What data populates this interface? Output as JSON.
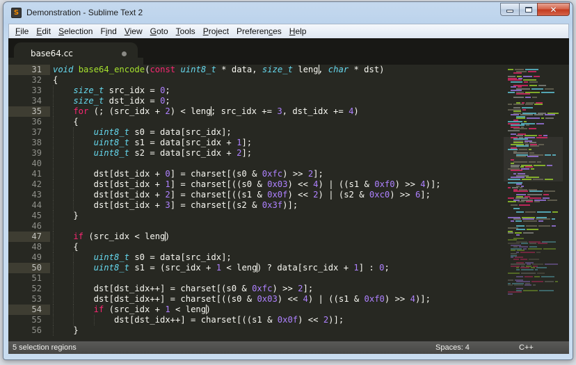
{
  "window": {
    "title": "Demonstration - Sublime Text 2",
    "app_icon_glyph": "S",
    "controls": {
      "minimize": "minimize",
      "maximize": "maximize",
      "close": "✕"
    }
  },
  "menu": [
    {
      "label": "File",
      "mnemonic_index": 0
    },
    {
      "label": "Edit",
      "mnemonic_index": 0
    },
    {
      "label": "Selection",
      "mnemonic_index": 0
    },
    {
      "label": "Find",
      "mnemonic_index": 1
    },
    {
      "label": "View",
      "mnemonic_index": 0
    },
    {
      "label": "Goto",
      "mnemonic_index": 0
    },
    {
      "label": "Tools",
      "mnemonic_index": 0
    },
    {
      "label": "Project",
      "mnemonic_index": 0
    },
    {
      "label": "Preferences",
      "mnemonic_index": 8
    },
    {
      "label": "Help",
      "mnemonic_index": 0
    }
  ],
  "tabs": [
    {
      "label": "base64.cc",
      "modified": true,
      "active": true
    }
  ],
  "colors": {
    "background": "#272822",
    "storage": "#66d9ef",
    "keyword": "#f92672",
    "function": "#a6e22e",
    "number": "#ae81ff",
    "text": "#f8f8f2",
    "line_highlight": "#3e3d32"
  },
  "editor": {
    "highlighted_lines": [
      31,
      35,
      47,
      50,
      54
    ],
    "lines": [
      {
        "n": 31,
        "indent": 0,
        "tokens": [
          [
            "s",
            "void"
          ],
          [
            "p",
            " "
          ],
          [
            "f",
            "base64_encode"
          ],
          [
            "p",
            "("
          ],
          [
            "k",
            "const"
          ],
          [
            "p",
            " "
          ],
          [
            "s",
            "uint8_t"
          ],
          [
            "p",
            " * data, "
          ],
          [
            "s",
            "size_t"
          ],
          [
            "p",
            " leng"
          ],
          [
            "c",
            ""
          ],
          [
            "p",
            ", "
          ],
          [
            "s",
            "char"
          ],
          [
            "p",
            " * dst)"
          ]
        ]
      },
      {
        "n": 32,
        "indent": 0,
        "tokens": [
          [
            "p",
            "{"
          ]
        ]
      },
      {
        "n": 33,
        "indent": 1,
        "tokens": [
          [
            "s",
            "size_t"
          ],
          [
            "p",
            " src_idx = "
          ],
          [
            "n",
            "0"
          ],
          [
            "p",
            ";"
          ]
        ]
      },
      {
        "n": 34,
        "indent": 1,
        "tokens": [
          [
            "s",
            "size_t"
          ],
          [
            "p",
            " dst_idx = "
          ],
          [
            "n",
            "0"
          ],
          [
            "p",
            ";"
          ]
        ]
      },
      {
        "n": 35,
        "indent": 1,
        "tokens": [
          [
            "k",
            "for"
          ],
          [
            "p",
            " (; (src_idx + "
          ],
          [
            "n",
            "2"
          ],
          [
            "p",
            ") < leng"
          ],
          [
            "c",
            ""
          ],
          [
            "p",
            "; src_idx += "
          ],
          [
            "n",
            "3"
          ],
          [
            "p",
            ", dst_idx += "
          ],
          [
            "n",
            "4"
          ],
          [
            "p",
            ")"
          ]
        ]
      },
      {
        "n": 36,
        "indent": 1,
        "tokens": [
          [
            "p",
            "{"
          ]
        ]
      },
      {
        "n": 37,
        "indent": 2,
        "tokens": [
          [
            "s",
            "uint8_t"
          ],
          [
            "p",
            " s0 = data[src_idx];"
          ]
        ]
      },
      {
        "n": 38,
        "indent": 2,
        "tokens": [
          [
            "s",
            "uint8_t"
          ],
          [
            "p",
            " s1 = data[src_idx + "
          ],
          [
            "n",
            "1"
          ],
          [
            "p",
            "];"
          ]
        ]
      },
      {
        "n": 39,
        "indent": 2,
        "tokens": [
          [
            "s",
            "uint8_t"
          ],
          [
            "p",
            " s2 = data[src_idx + "
          ],
          [
            "n",
            "2"
          ],
          [
            "p",
            "];"
          ]
        ]
      },
      {
        "n": 40,
        "indent": 2,
        "tokens": []
      },
      {
        "n": 41,
        "indent": 2,
        "tokens": [
          [
            "p",
            "dst[dst_idx + "
          ],
          [
            "n",
            "0"
          ],
          [
            "p",
            "] = charset[(s0 & "
          ],
          [
            "n",
            "0xfc"
          ],
          [
            "p",
            ") >> "
          ],
          [
            "n",
            "2"
          ],
          [
            "p",
            "];"
          ]
        ]
      },
      {
        "n": 42,
        "indent": 2,
        "tokens": [
          [
            "p",
            "dst[dst_idx + "
          ],
          [
            "n",
            "1"
          ],
          [
            "p",
            "] = charset[((s0 & "
          ],
          [
            "n",
            "0x03"
          ],
          [
            "p",
            ") << "
          ],
          [
            "n",
            "4"
          ],
          [
            "p",
            ") | ((s1 & "
          ],
          [
            "n",
            "0xf0"
          ],
          [
            "p",
            ") >> "
          ],
          [
            "n",
            "4"
          ],
          [
            "p",
            ")];"
          ]
        ]
      },
      {
        "n": 43,
        "indent": 2,
        "tokens": [
          [
            "p",
            "dst[dst_idx + "
          ],
          [
            "n",
            "2"
          ],
          [
            "p",
            "] = charset[((s1 & "
          ],
          [
            "n",
            "0x0f"
          ],
          [
            "p",
            ") << "
          ],
          [
            "n",
            "2"
          ],
          [
            "p",
            ") | (s2 & "
          ],
          [
            "n",
            "0xc0"
          ],
          [
            "p",
            ") >> "
          ],
          [
            "n",
            "6"
          ],
          [
            "p",
            "];"
          ]
        ]
      },
      {
        "n": 44,
        "indent": 2,
        "tokens": [
          [
            "p",
            "dst[dst_idx + "
          ],
          [
            "n",
            "3"
          ],
          [
            "p",
            "] = charset[(s2 & "
          ],
          [
            "n",
            "0x3f"
          ],
          [
            "p",
            ")];"
          ]
        ]
      },
      {
        "n": 45,
        "indent": 1,
        "tokens": [
          [
            "p",
            "}"
          ]
        ]
      },
      {
        "n": 46,
        "indent": 1,
        "tokens": []
      },
      {
        "n": 47,
        "indent": 1,
        "tokens": [
          [
            "k",
            "if"
          ],
          [
            "p",
            " (src_idx < leng"
          ],
          [
            "c",
            ""
          ],
          [
            "p",
            ")"
          ]
        ]
      },
      {
        "n": 48,
        "indent": 1,
        "tokens": [
          [
            "p",
            "{"
          ]
        ]
      },
      {
        "n": 49,
        "indent": 2,
        "tokens": [
          [
            "s",
            "uint8_t"
          ],
          [
            "p",
            " s0 = data[src_idx];"
          ]
        ]
      },
      {
        "n": 50,
        "indent": 2,
        "tokens": [
          [
            "s",
            "uint8_t"
          ],
          [
            "p",
            " s1 = (src_idx + "
          ],
          [
            "n",
            "1"
          ],
          [
            "p",
            " < leng"
          ],
          [
            "c",
            ""
          ],
          [
            "p",
            ") ? data[src_idx + "
          ],
          [
            "n",
            "1"
          ],
          [
            "p",
            "] : "
          ],
          [
            "n",
            "0"
          ],
          [
            "p",
            ";"
          ]
        ]
      },
      {
        "n": 51,
        "indent": 2,
        "tokens": []
      },
      {
        "n": 52,
        "indent": 2,
        "tokens": [
          [
            "p",
            "dst[dst_idx++] = charset[(s0 & "
          ],
          [
            "n",
            "0xfc"
          ],
          [
            "p",
            ") >> "
          ],
          [
            "n",
            "2"
          ],
          [
            "p",
            "];"
          ]
        ]
      },
      {
        "n": 53,
        "indent": 2,
        "tokens": [
          [
            "p",
            "dst[dst_idx++] = charset[((s0 & "
          ],
          [
            "n",
            "0x03"
          ],
          [
            "p",
            ") << "
          ],
          [
            "n",
            "4"
          ],
          [
            "p",
            ") | ((s1 & "
          ],
          [
            "n",
            "0xf0"
          ],
          [
            "p",
            ") >> "
          ],
          [
            "n",
            "4"
          ],
          [
            "p",
            ")];"
          ]
        ]
      },
      {
        "n": 54,
        "indent": 2,
        "tokens": [
          [
            "k",
            "if"
          ],
          [
            "p",
            " (src_idx + "
          ],
          [
            "n",
            "1"
          ],
          [
            "p",
            " < leng"
          ],
          [
            "c",
            ""
          ],
          [
            "p",
            ")"
          ]
        ]
      },
      {
        "n": 55,
        "indent": 3,
        "tokens": [
          [
            "p",
            "dst[dst_idx++] = charset[((s1 & "
          ],
          [
            "n",
            "0x0f"
          ],
          [
            "p",
            ") << "
          ],
          [
            "n",
            "2"
          ],
          [
            "p",
            ")];"
          ]
        ]
      },
      {
        "n": 56,
        "indent": 1,
        "tokens": [
          [
            "p",
            "}"
          ]
        ]
      }
    ]
  },
  "status": {
    "left": "5 selection regions",
    "indentation": "Spaces: 4",
    "syntax": "C++"
  }
}
